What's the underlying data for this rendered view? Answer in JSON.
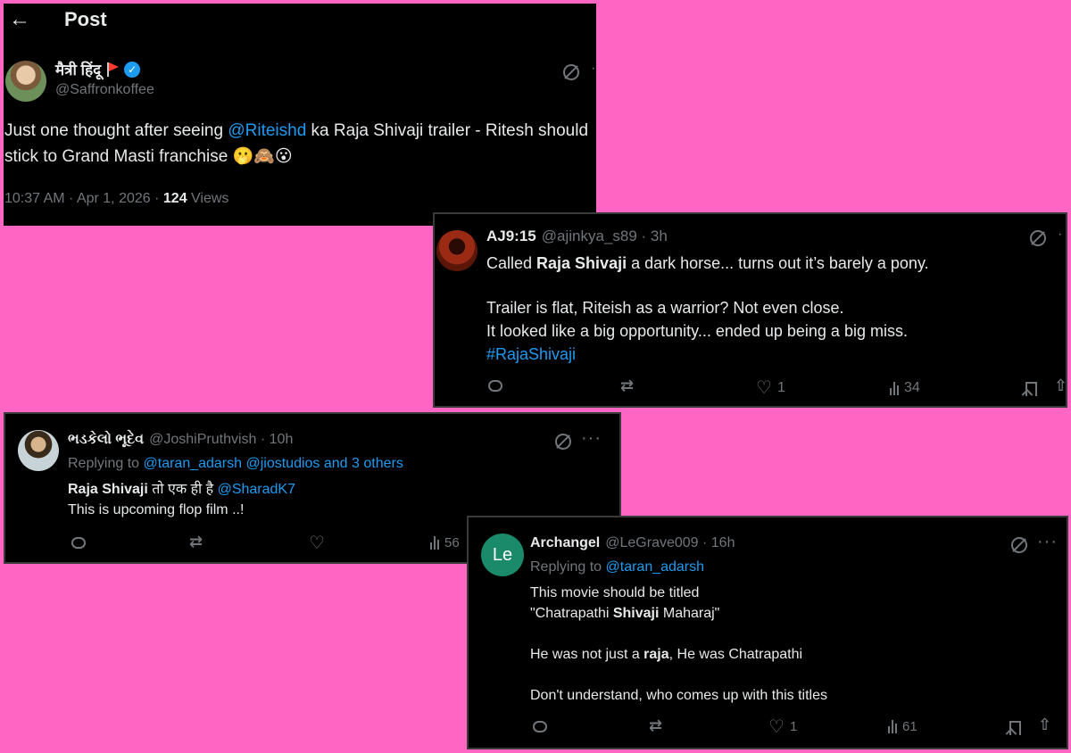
{
  "post1": {
    "header_title": "Post",
    "display_name": "मैत्री हिंदू",
    "handle": "@Saffronkoffee",
    "text_before": "Just one thought after seeing ",
    "mention": "@Riteishd",
    "text_after": " ka Raja Shivaji trailer - Ritesh should stick to Grand Masti franchise 🫢🙈😮",
    "time_date": "10:37 AM · Apr 1, 2026 · ",
    "views_count": "124",
    "views_label": " Views"
  },
  "post2": {
    "display_name": "AJ9:15",
    "handle": "@ajinkya_s89 · 3h",
    "line1_pre": "Called ",
    "line1_bold": "Raja Shivaji",
    "line1_post": " a dark horse... turns out it’s barely a pony.",
    "line2": "Trailer is flat, Riteish as a warrior? Not even close.",
    "line3": "It looked like a big opportunity... ended up being a big miss.",
    "hashtag": "#RajaShivaji",
    "likes": "1",
    "views": "34"
  },
  "post3": {
    "display_name": "ભડકેલો ભૂદેવ",
    "handle": "@JoshiPruthvish · 10h",
    "replying_label": "Replying to ",
    "replying_to": "@taran_adarsh @jiostudios and 3 others",
    "line1_bold": "Raja Shivaji",
    "line1_post": " तो एक ही है ",
    "line1_mention": "@SharadK7",
    "line2": "This is upcoming flop film ..!",
    "views": "56"
  },
  "post4": {
    "avatar_text": "Le",
    "display_name": "Archangel",
    "handle": "@LeGrave009 · 16h",
    "replying_label": "Replying to ",
    "replying_to": "@taran_adarsh",
    "line1": "This movie should be titled",
    "line2_pre": "\"Chatrapathi ",
    "line2_bold": "Shivaji",
    "line2_post": " Maharaj\"",
    "line3_pre": "He was not just a ",
    "line3_bold": "raja",
    "line3_post": ", He was Chatrapathi",
    "line4": "Don't understand,  who comes up with this titles",
    "likes": "1",
    "views": "61"
  },
  "colors": {
    "background": "#ff66c4",
    "card": "#000000",
    "link": "#1d9bf0",
    "muted": "#71767b",
    "text": "#e7e9ea",
    "avatar_le": "#1a8a6a"
  }
}
